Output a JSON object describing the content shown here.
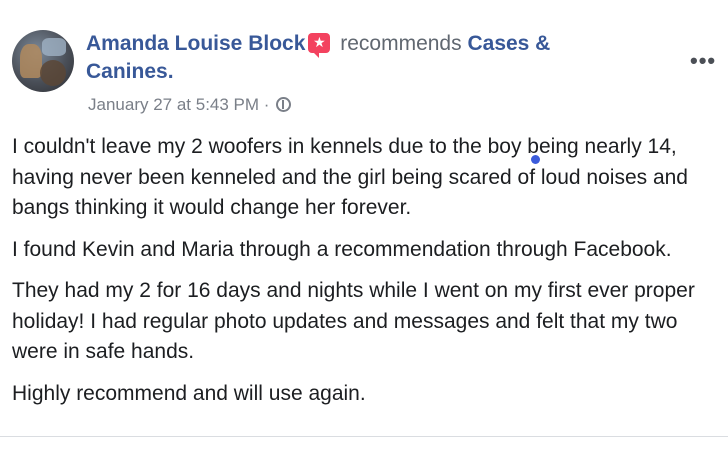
{
  "post": {
    "author": "Amanda Louise Block",
    "recommends_text": "recommends",
    "page_name_line1": "Cases &",
    "page_name_line2": "Canines.",
    "timestamp": "January 27 at 5:43 PM ·",
    "more_label": "•••",
    "badge_icon": "★",
    "paragraphs": [
      "I couldn't leave my 2 woofers in kennels due to the boy being nearly 14, having never been kenneled and the girl being scared of loud noises and bangs thinking it would change her forever.",
      "I found Kevin and Maria through a recommendation through Facebook.",
      "They had my 2 for 16 days and nights while I went on my first ever proper holiday! I had regular photo updates and messages and felt that my two were in safe hands.",
      "Highly recommend and will use again."
    ]
  },
  "colors": {
    "link": "#385898",
    "badge": "#f3425f",
    "meta": "#7a7f88",
    "text": "#1c1e21"
  }
}
